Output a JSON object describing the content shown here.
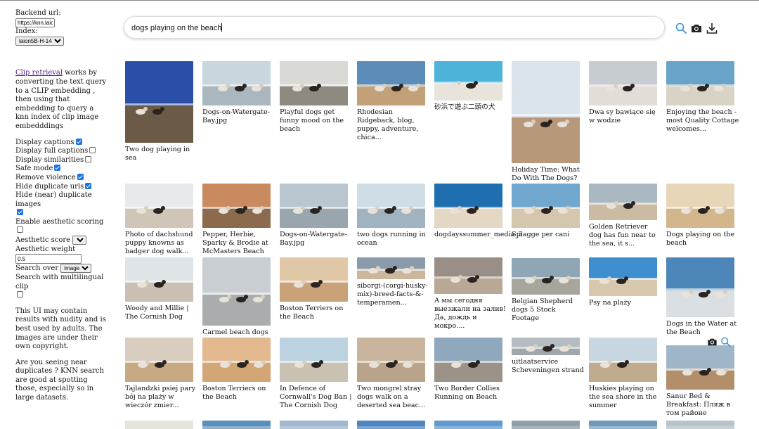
{
  "sidebar": {
    "backend_label": "Backend url:",
    "backend_value": "https://knn.laion.ai",
    "index_label": "Index:",
    "index_value": "laion5B-H-14",
    "intro_link": "Clip retrieval",
    "intro_text": " works by converting the text query to a CLIP embedding , then using that embedding to query a knn index of clip image embedddings",
    "options": [
      {
        "label": "Display captions",
        "checked": true
      },
      {
        "label": "Display full captions",
        "checked": false
      },
      {
        "label": "Display similarities",
        "checked": false
      },
      {
        "label": "Safe mode",
        "checked": true
      },
      {
        "label": "Remove violence",
        "checked": true
      },
      {
        "label": "Hide duplicate urls",
        "checked": true
      },
      {
        "label": "Hide (near) duplicate images",
        "checked": true
      },
      {
        "label": "Enable aesthetic scoring",
        "checked": false
      }
    ],
    "aesthetic_score_label": "Aesthetic score",
    "aesthetic_score_value": "",
    "aesthetic_weight_label": "Aesthetic weight",
    "aesthetic_weight_value": "0.5",
    "search_over_label": "Search over",
    "search_over_value": "image",
    "multilingual_label": "Search with multilingual clip",
    "multilingual_checked": false,
    "disclaimer": "This UI may contain results with nudity and is best used by adults. The images are under their own copyright.",
    "duplicates_note": "Are you seeing near duplicates ? KNN search are good at spotting those, especially so in large datasets."
  },
  "search": {
    "query": "dogs playing on the beach",
    "icons": [
      "search-icon",
      "camera-icon",
      "download-icon"
    ]
  },
  "results": [
    {
      "caption": "Two dog playing in sea",
      "sky": "#2b4fa8",
      "sand": "#6b5a45"
    },
    {
      "caption": "Dogs-on-Watergate-Bay.jpg",
      "sky": "#c9d6de",
      "sand": "#aab7bf"
    },
    {
      "caption": "Playful dogs get funny mood on the beach",
      "sky": "#d9dad6",
      "sand": "#8f8a80"
    },
    {
      "caption": "Rhodesian Ridgeback, blog, puppy, adventure, chica...",
      "sky": "#5b8db8",
      "sand": "#c2a078"
    },
    {
      "caption": "砂浜で遊ぶ二頭の犬",
      "sky": "#4db3d9",
      "sand": "#e8e4dc"
    },
    {
      "caption": "Holiday Time: What Do With The Dogs?",
      "sky": "#dbe4ea",
      "sand": "#b8987a"
    },
    {
      "caption": "Dwa sy bawiące się w wodzie",
      "sky": "#c6ccd0",
      "sand": "#e2ddd6"
    },
    {
      "caption": "Enjoying the beach - most Quality Cottage welcomes...",
      "sky": "#6aa3c8",
      "sand": "#d9d3c6"
    },
    {
      "caption": "Photo of dachshund puppy knowns as badger dog walk...",
      "sky": "#e6eaed",
      "sand": "#cfc6b8"
    },
    {
      "caption": "Pepper, Herbie, Sparky & Brodie at McMasters Beach",
      "sky": "#c98a60",
      "sand": "#8c6a4e"
    },
    {
      "caption": "Dogs-on-Watergate-Bay.jpg",
      "sky": "#b9c6cf",
      "sand": "#9aa6ad"
    },
    {
      "caption": "two dogs running in ocean",
      "sky": "#cfdde6",
      "sand": "#9fb3c0"
    },
    {
      "caption": "dogdayssummer_media_3",
      "sky": "#1f6fb0",
      "sand": "#e4d8c4"
    },
    {
      "caption": "Spiagge per cani",
      "sky": "#6fa7cf",
      "sand": "#d5c7ad"
    },
    {
      "caption": "Golden Retriever dog has fun near to the sea, it s...",
      "sky": "#aab8c2",
      "sand": "#cbbba3"
    },
    {
      "caption": "Dogs playing on the beach",
      "sky": "#e8d6b9",
      "sand": "#d4b68c"
    },
    {
      "caption": "Woody and Millie | The Cornish Dog",
      "sky": "#dfe4e8",
      "sand": "#c9bfb2"
    },
    {
      "caption": "Carmel beach dogs",
      "sky": "#c8ced2",
      "sand": "#a9adae"
    },
    {
      "caption": "Boston Terriers on the Beach",
      "sky": "#e0c8a6",
      "sand": "#c9a27a"
    },
    {
      "caption": "siborgi-(corgi-husky-mix)-breed-facts-&-temperamen...",
      "sky": "#8a9aab",
      "sand": "#cbb79c"
    },
    {
      "caption": "А мы сегодня выезжали на залив! Да, дождь и мокро....",
      "sky": "#9a8f86",
      "sand": "#b9a895"
    },
    {
      "caption": "Belgian Shepherd dogs 5 Stock Footage",
      "sky": "#90a6b4",
      "sand": "#a8a69c"
    },
    {
      "caption": "Psy na plaży",
      "sky": "#3d8fcf",
      "sand": "#d8c9ae"
    },
    {
      "caption": "Dogs in the Water at the Beach",
      "sky": "#4d86b8",
      "sand": "#d9dfe3"
    },
    {
      "caption": "Tajlandzki psiej pary bój na plaży w wieczór zmier...",
      "sky": "#d8cdbf",
      "sand": "#c7a983"
    },
    {
      "caption": "Boston Terriers on the Beach",
      "sky": "#e3b98f",
      "sand": "#d2a675"
    },
    {
      "caption": "In Defence of Cornwall's Dog Ban | The Cornish Dog",
      "sky": "#bcd2e0",
      "sand": "#c9c1b2"
    },
    {
      "caption": "Two mongrel stray dogs walk on a deserted sea beac...",
      "sky": "#c9b59e",
      "sand": "#b9a48b"
    },
    {
      "caption": "Two Border Collies Running on Beach",
      "sky": "#8fa8bd",
      "sand": "#9b9387"
    },
    {
      "caption": "uitlaatservice Scheveningen strand",
      "sky": "#b4bcc2",
      "sand": "#9ea7ad"
    },
    {
      "caption": "Huskies playing on the sea shore in the summer",
      "sky": "#c7d6e0",
      "sand": "#c1ab8e"
    },
    {
      "caption": "Sanur Bed & Breakfast: Пляж в том районе",
      "sky": "#9fb6c8",
      "sand": "#b38e6b"
    },
    {
      "caption": "",
      "sky": "#e7e4dc",
      "sand": "#e7e4dc"
    },
    {
      "caption": "",
      "sky": "#5b8fbd",
      "sand": "#8fb2cf"
    },
    {
      "caption": "",
      "sky": "#9db8cf",
      "sand": "#b6c8d6"
    },
    {
      "caption": "",
      "sky": "#4c86c2",
      "sand": "#7ba6cf"
    },
    {
      "caption": "",
      "sky": "#5f9bd0",
      "sand": "#8ab6da"
    },
    {
      "caption": "",
      "sky": "#8fa0ad",
      "sand": "#a9b4bc"
    },
    {
      "caption": "",
      "sky": "#6f98bd",
      "sand": "#9dbad3"
    },
    {
      "caption": "",
      "sky": "#b8c4cc",
      "sand": "#c9d0d5"
    }
  ],
  "hover_icons": [
    "camera-icon",
    "search-icon"
  ]
}
